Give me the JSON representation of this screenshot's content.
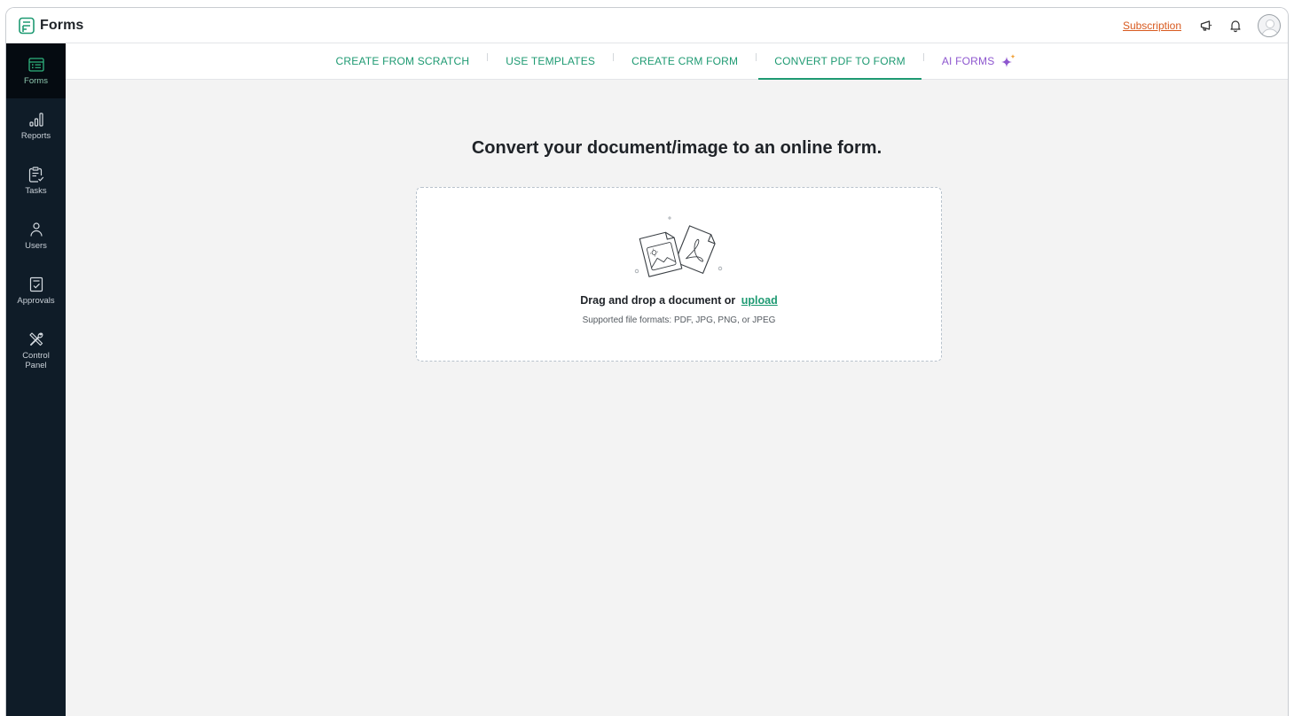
{
  "app": {
    "title": "Forms"
  },
  "header": {
    "subscription_label": "Subscription",
    "icons": [
      "megaphone-icon",
      "bell-icon",
      "user-avatar"
    ]
  },
  "sidebar": {
    "items": [
      {
        "label": "Forms",
        "icon": "forms-icon",
        "active": true
      },
      {
        "label": "Reports",
        "icon": "reports-icon"
      },
      {
        "label": "Tasks",
        "icon": "tasks-icon"
      },
      {
        "label": "Users",
        "icon": "users-icon"
      },
      {
        "label": "Approvals",
        "icon": "approvals-icon"
      },
      {
        "label": "Control\nPanel",
        "icon": "control-panel-icon"
      }
    ]
  },
  "tabs": [
    {
      "label": "CREATE FROM SCRATCH"
    },
    {
      "label": "USE TEMPLATES"
    },
    {
      "label": "CREATE CRM FORM"
    },
    {
      "label": "CONVERT PDF TO FORM",
      "active": true
    },
    {
      "label": "AI FORMS",
      "icon": "sparkle-icon"
    }
  ],
  "main": {
    "heading": "Convert your document/image to an online form.",
    "dropzone": {
      "prompt": "Drag and drop a document or",
      "upload_label": "upload",
      "formats": "Supported file formats: PDF, JPG, PNG, or JPEG"
    }
  },
  "colors": {
    "accent": "#1e9a72",
    "ai_accent": "#8e57cf",
    "sidebar_bg": "#0f1c28",
    "subscription": "#d85a1f"
  }
}
